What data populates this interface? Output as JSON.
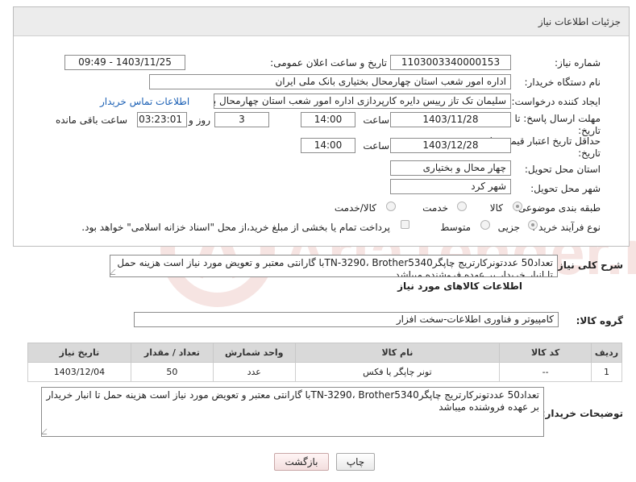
{
  "header": {
    "title": "جزئیات اطلاعات نیاز"
  },
  "fields": {
    "need_number_label": "شماره نیاز:",
    "need_number": "1103003340000153",
    "announce_label": "تاریخ و ساعت اعلان عمومی:",
    "announce_value": "1403/11/25 - 09:49",
    "buyer_org_label": "نام دستگاه خریدار:",
    "buyer_org": "اداره امور شعب استان چهارمحال بختیاری بانک ملی ایران",
    "creator_label": "ایجاد کننده درخواست:",
    "creator": "سلیمان تک تاز رییس دایره کارپردازی  اداره امور شعب استان چهارمحال بختیاری",
    "contact_link": "اطلاعات تماس خریدار",
    "deadline_label": "مهلت ارسال پاسخ: تا تاریخ:",
    "deadline_date": "1403/11/28",
    "time_label": "ساعت",
    "deadline_time": "14:00",
    "days_value": "3",
    "days_label": "روز و",
    "remaining_value": "03:23:01",
    "remaining_label": "ساعت باقی مانده",
    "min_validity_label": "حداقل تاریخ اعتبار قیمت: تا تاریخ:",
    "validity_date": "1403/12/28",
    "validity_time": "14:00",
    "delivery_province_label": "استان محل تحویل:",
    "delivery_province": "چهار محال و بختیاری",
    "delivery_city_label": "شهر محل تحویل:",
    "delivery_city": "شهر کرد",
    "category_label": "طبقه بندی موضوعی:",
    "category_options": [
      "کالا",
      "خدمت",
      "کالا/خدمت"
    ],
    "process_label": "نوع فرآیند خرید :",
    "process_options": [
      "جزیی",
      "متوسط"
    ],
    "payment_note": "پرداخت تمام یا بخشی از مبلغ خرید،از محل \"اسناد خزانه اسلامی\" خواهد بود."
  },
  "summary": {
    "label": "شرح کلی نیاز:",
    "text": "تعداد50 عددتونرکارتریج چاپگرTN-3290، Brother5340با گارانتی معتبر و تعویض مورد نیاز است هزینه حمل تا انبار خریدار بر عهده فروشنده میباشد"
  },
  "goods_section": {
    "title": "اطلاعات کالاهای مورد نیاز",
    "group_label": "گروه کالا:",
    "group_value": "کامپیوتر و فناوری اطلاعات-سخت افزار",
    "columns": [
      "ردیف",
      "کد کالا",
      "نام کالا",
      "واحد شمارش",
      "تعداد / مقدار",
      "تاریخ نیاز"
    ],
    "rows": [
      {
        "row": "1",
        "code": "--",
        "name": "تونر چاپگر یا فکس",
        "unit": "عدد",
        "qty": "50",
        "date": "1403/12/04"
      }
    ]
  },
  "buyer_notes": {
    "label": "توضیحات خریدار:",
    "text": "تعداد50 عددتونرکارتریج چاپگرTN-3290، Brother5340با گارانتی معتبر و تعویض مورد نیاز است هزینه حمل تا انبار خریدار بر عهده فروشنده میباشد"
  },
  "buttons": {
    "print": "چاپ",
    "back": "بازگشت"
  },
  "watermark": {
    "text": "AriaTender.neT"
  }
}
